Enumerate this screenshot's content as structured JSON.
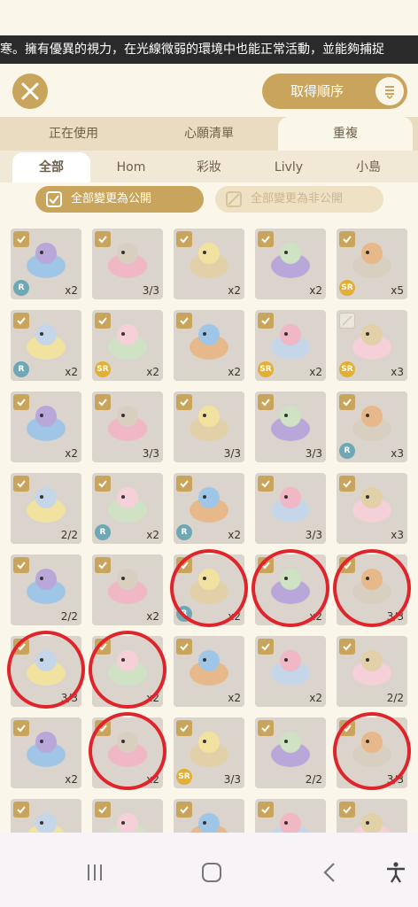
{
  "ticker": "寒。擁有優異的視力，在光線微弱的環境中也能正常活動，並能夠捕捉",
  "header": {
    "sort_label": "取得順序"
  },
  "tabs_primary": [
    {
      "label": "正在使用"
    },
    {
      "label": "心願清單"
    },
    {
      "label": "重複"
    }
  ],
  "tabs_secondary": [
    {
      "label": "全部"
    },
    {
      "label": "Hom"
    },
    {
      "label": "彩妝"
    },
    {
      "label": "Livly"
    },
    {
      "label": "小島"
    }
  ],
  "actions": {
    "make_public": "全部變更為公開",
    "make_private": "全部變更為非公開"
  },
  "colors": {
    "accent": "#c8a45c",
    "bg": "#fbf6ea",
    "tab_bg": "#e9dcc0",
    "highlight": "#e0242b"
  },
  "items": [
    {
      "icon": "blue-hair-icon",
      "rarity": "R",
      "count": "x2",
      "checked": true
    },
    {
      "icon": "rainbow-icon",
      "rarity": "",
      "count": "3/3",
      "checked": true
    },
    {
      "icon": "skirt-stockings-icon",
      "rarity": "",
      "count": "x2",
      "checked": true
    },
    {
      "icon": "blue-bow-outfit-icon",
      "rarity": "",
      "count": "x2",
      "checked": true
    },
    {
      "icon": "gothic-dress-icon",
      "rarity": "SR",
      "count": "x5",
      "checked": true
    },
    {
      "icon": "black-jacket-icon",
      "rarity": "R",
      "count": "x2",
      "checked": true
    },
    {
      "icon": "maid-outfit-icon",
      "rarity": "SR",
      "count": "x2",
      "checked": true
    },
    {
      "icon": "flower-bush-icon",
      "rarity": "",
      "count": "x2",
      "checked": true
    },
    {
      "icon": "red-dress-icon",
      "rarity": "SR",
      "count": "x2",
      "checked": true
    },
    {
      "icon": "lilac-curls-icon",
      "rarity": "SR",
      "count": "x3",
      "checked": false
    },
    {
      "icon": "lilac-wings-icon",
      "rarity": "",
      "count": "x2",
      "checked": true
    },
    {
      "icon": "purple-bow-icon",
      "rarity": "",
      "count": "3/3",
      "checked": true
    },
    {
      "icon": "plaid-hat-icon",
      "rarity": "",
      "count": "3/3",
      "checked": true
    },
    {
      "icon": "flower-headband-icon",
      "rarity": "",
      "count": "3/3",
      "checked": true
    },
    {
      "icon": "rainbow-top-hat-icon",
      "rarity": "R",
      "count": "x3",
      "checked": true
    },
    {
      "icon": "yellow-mushroom-icon",
      "rarity": "",
      "count": "2/2",
      "checked": true
    },
    {
      "icon": "white-wig-icon",
      "rarity": "R",
      "count": "x2",
      "checked": true
    },
    {
      "icon": "crystal-cloud-icon",
      "rarity": "R",
      "count": "x2",
      "checked": true
    },
    {
      "icon": "pink-donut-icon",
      "rarity": "",
      "count": "3/3",
      "checked": true
    },
    {
      "icon": "golden-wand-icon",
      "rarity": "",
      "count": "x3",
      "checked": true
    },
    {
      "icon": "gold-mirror-icon",
      "rarity": "",
      "count": "2/2",
      "checked": true
    },
    {
      "icon": "overall-outfit-icon",
      "rarity": "",
      "count": "x2",
      "checked": true
    },
    {
      "icon": "blue-whale-hat-icon",
      "rarity": "R",
      "count": "x2",
      "checked": true
    },
    {
      "icon": "pink-whale-hat-icon",
      "rarity": "",
      "count": "x2",
      "checked": true
    },
    {
      "icon": "brown-whale-hat-icon",
      "rarity": "",
      "count": "3/3",
      "checked": true
    },
    {
      "icon": "yellow-whale-hat-icon",
      "rarity": "",
      "count": "3/3",
      "checked": true
    },
    {
      "icon": "blonde-braid-icon",
      "rarity": "",
      "count": "x2",
      "checked": true
    },
    {
      "icon": "knit-sweater-icon",
      "rarity": "",
      "count": "x2",
      "checked": true
    },
    {
      "icon": "black-scorpion-icon",
      "rarity": "",
      "count": "x2",
      "checked": true
    },
    {
      "icon": "purple-crown-icon",
      "rarity": "",
      "count": "2/2",
      "checked": true
    },
    {
      "icon": "bead-necklace-icon",
      "rarity": "",
      "count": "x2",
      "checked": true
    },
    {
      "icon": "pink-puff-icon",
      "rarity": "",
      "count": "x2",
      "checked": true
    },
    {
      "icon": "green-bucket-hat-icon",
      "rarity": "SR",
      "count": "3/3",
      "checked": true
    },
    {
      "icon": "green-creature-icon",
      "rarity": "",
      "count": "2/2",
      "checked": true
    },
    {
      "icon": "honey-drip-icon",
      "rarity": "",
      "count": "3/3",
      "checked": true
    },
    {
      "icon": "lace-dress-icon",
      "rarity": "",
      "count": "",
      "checked": true
    },
    {
      "icon": "black-top-hat-icon",
      "rarity": "",
      "count": "",
      "checked": true
    },
    {
      "icon": "pale-face-icon",
      "rarity": "",
      "count": "",
      "checked": true
    },
    {
      "icon": "white-outfit-icon",
      "rarity": "",
      "count": "",
      "checked": true
    },
    {
      "icon": "heart-lamp-icon",
      "rarity": "",
      "count": "",
      "checked": true
    }
  ]
}
